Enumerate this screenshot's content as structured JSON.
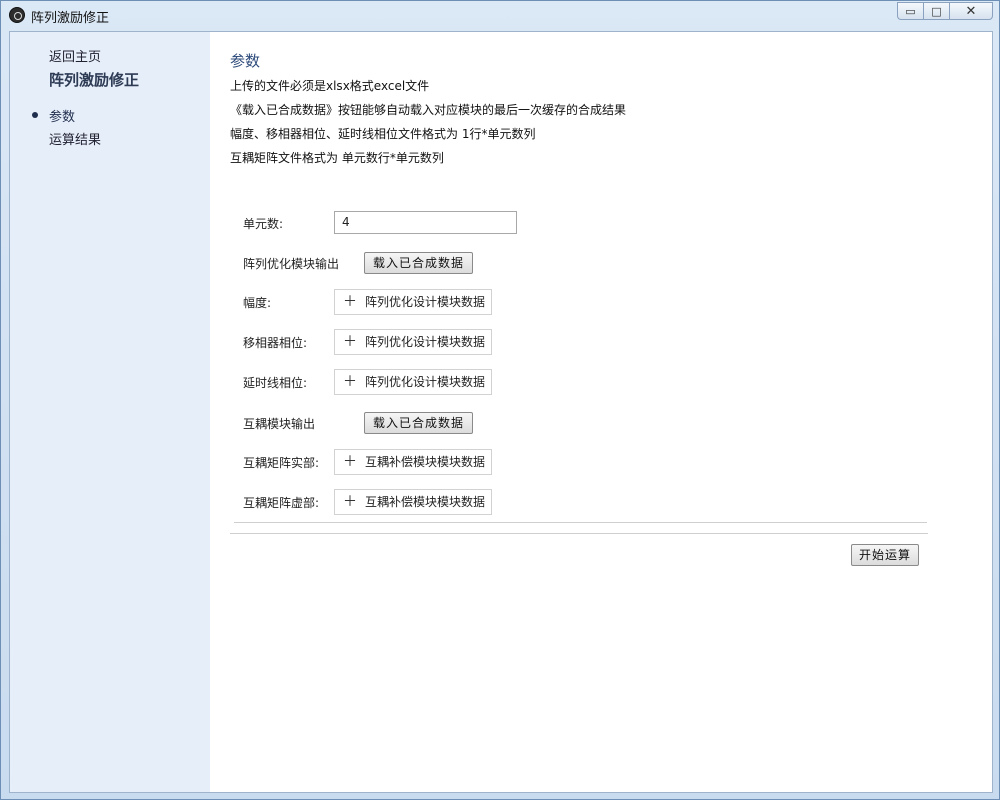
{
  "window": {
    "title": "阵列激励修正",
    "minimize": "▭",
    "restore": "□",
    "close": "✕"
  },
  "sidebar": {
    "back_link": "返回主页",
    "title": "阵列激励修正",
    "items": [
      {
        "label": "参数",
        "active": true
      },
      {
        "label": "运算结果",
        "active": false
      }
    ]
  },
  "main": {
    "section_title": "参数",
    "notes": [
      "上传的文件必须是xlsx格式excel文件",
      "《载入已合成数据》按钮能够自动载入对应模块的最后一次缓存的合成结果",
      "幅度、移相器相位、延时线相位文件格式为 1行*单元数列",
      "互耦矩阵文件格式为 单元数行*单元数列"
    ],
    "form": {
      "unit_count_label": "单元数:",
      "unit_count_value": "4",
      "array_opt_output_label": "阵列优化模块输出",
      "load_button_1": "载入已合成数据",
      "amplitude_label": "幅度:",
      "amplitude_upload": "阵列优化设计模块数据",
      "phase_shifter_label": "移相器相位:",
      "phase_shifter_upload": "阵列优化设计模块数据",
      "delay_line_label": "延时线相位:",
      "delay_line_upload": "阵列优化设计模块数据",
      "coupling_output_label": "互耦模块输出",
      "load_button_2": "载入已合成数据",
      "coupling_real_label": "互耦矩阵实部:",
      "coupling_real_upload": "互耦补偿模块模块数据",
      "coupling_imag_label": "互耦矩阵虚部:",
      "coupling_imag_upload": "互耦补偿模块模块数据",
      "plus_symbol": "＋"
    },
    "start_button": "开始运算"
  }
}
